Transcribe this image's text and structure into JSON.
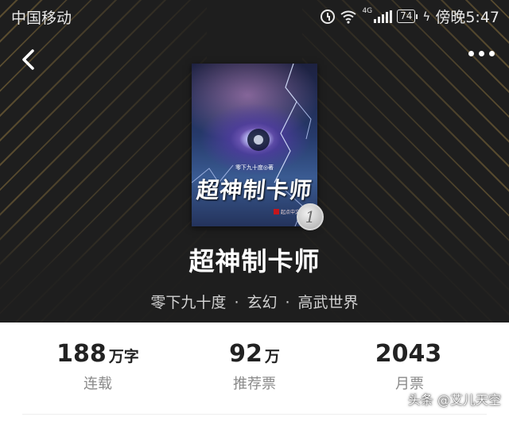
{
  "status_bar": {
    "carrier": "中国移动",
    "network": "4G",
    "battery": "74",
    "time": "傍晚5:47",
    "icons": [
      "alarm-icon",
      "wifi-icon",
      "signal-icon",
      "battery-icon",
      "charging-bolt-icon"
    ]
  },
  "nav": {
    "back_icon": "chevron-left-icon",
    "more_icon": "more-dots-icon"
  },
  "cover": {
    "author_line": "零下九十度◎著",
    "title": "超神制卡师",
    "publisher": "起点中文网",
    "rank_badge": "1"
  },
  "book": {
    "title": "超神制卡师",
    "author": "零下九十度",
    "genre": "玄幻",
    "subgenre": "高武世界",
    "separator": "·"
  },
  "stats": [
    {
      "value": "188",
      "unit": "万字",
      "label": "连载"
    },
    {
      "value": "92",
      "unit": "万",
      "label": "推荐票"
    },
    {
      "value": "2043",
      "unit": "",
      "label": "月票"
    }
  ],
  "watermark": "头条 @艾儿天空",
  "colors": {
    "hero_bg": "#1e1e1e",
    "stripe_gold": "#6d5b35",
    "text_light": "#ffffff",
    "meta_text": "#d2d2d2",
    "stat_value": "#222222",
    "stat_label": "#8a8a8a"
  }
}
